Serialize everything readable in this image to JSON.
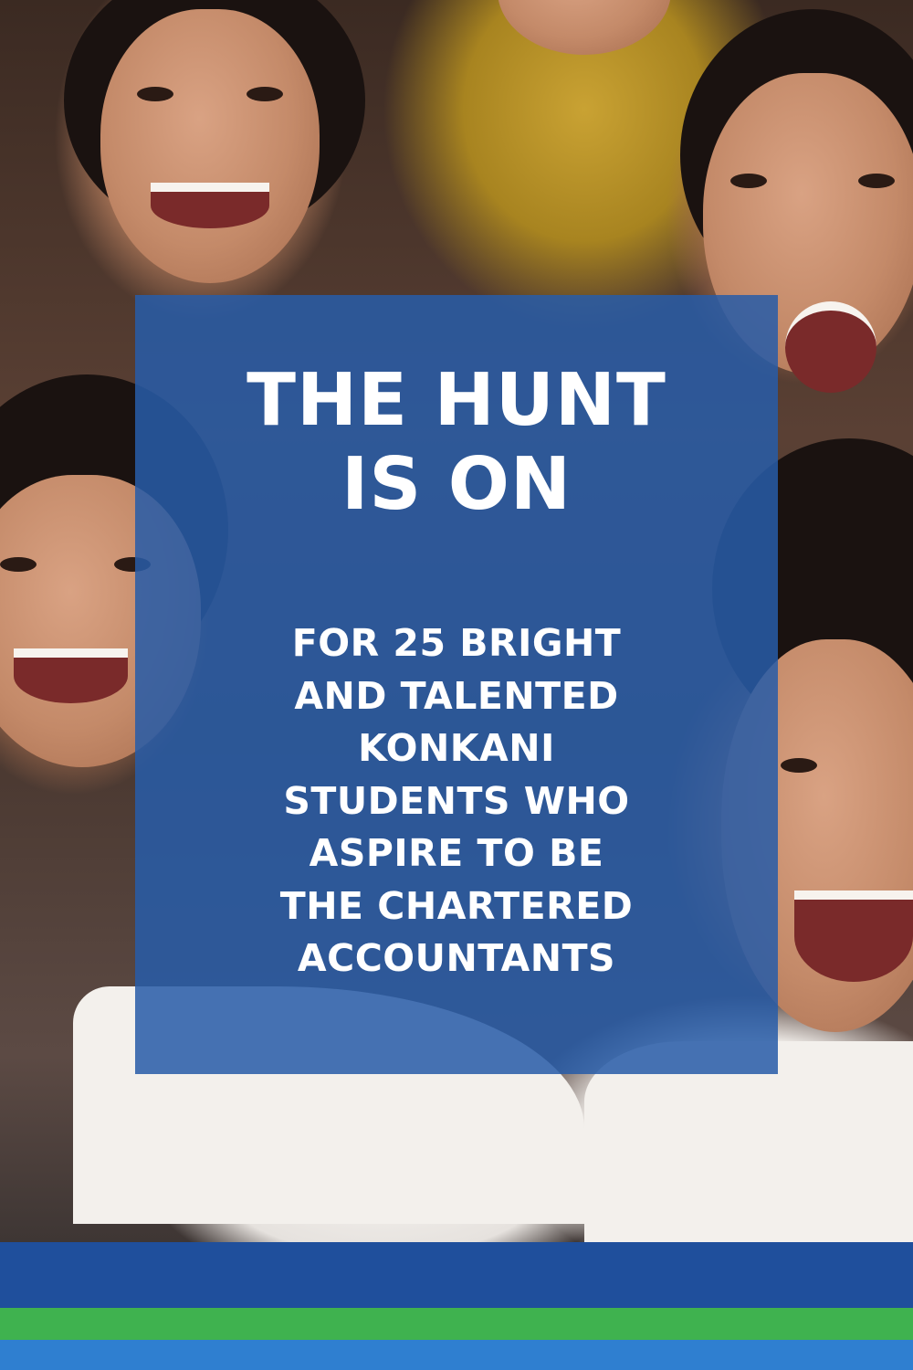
{
  "headline": {
    "lines": [
      "THE HUNT",
      "IS ON"
    ]
  },
  "subline": {
    "lines": [
      "FOR 25 BRIGHT",
      "AND TALENTED",
      "KONKANI",
      "STUDENTS WHO",
      "ASPIRE TO BE",
      "THE CHARTERED",
      "ACCOUNTANTS"
    ]
  },
  "colors": {
    "overlay_blue": "#285ca8",
    "stripe_dark_blue": "#1f4f9c",
    "stripe_green": "#3fb24f",
    "stripe_light_blue": "#2f7fd0",
    "text": "#ffffff"
  }
}
